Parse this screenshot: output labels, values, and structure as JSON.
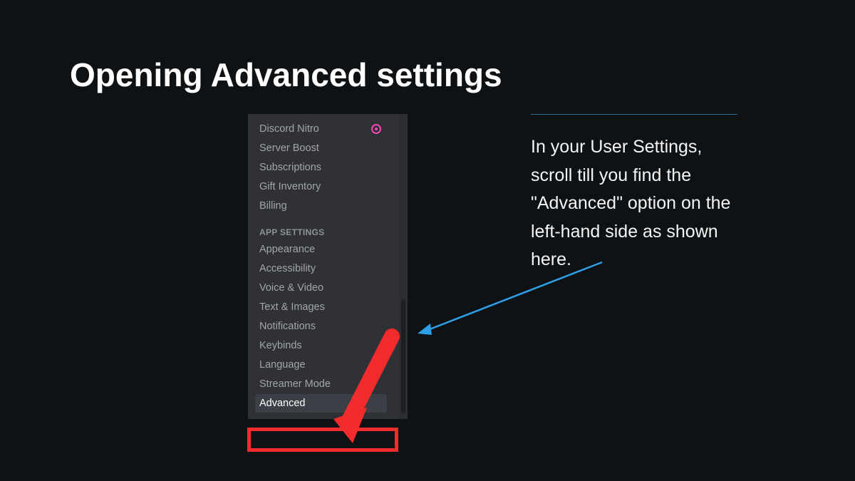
{
  "slide": {
    "title": "Opening Advanced settings"
  },
  "sidebar": {
    "items_top": [
      {
        "label": "Discord Nitro",
        "badge": true
      },
      {
        "label": "Server Boost"
      },
      {
        "label": "Subscriptions"
      },
      {
        "label": "Gift Inventory"
      },
      {
        "label": "Billing"
      }
    ],
    "section_header": "APP SETTINGS",
    "items_app": [
      {
        "label": "Appearance"
      },
      {
        "label": "Accessibility"
      },
      {
        "label": "Voice & Video"
      },
      {
        "label": "Text & Images"
      },
      {
        "label": "Notifications"
      },
      {
        "label": "Keybinds"
      },
      {
        "label": "Language"
      },
      {
        "label": "Streamer Mode"
      },
      {
        "label": "Advanced",
        "selected": true
      }
    ]
  },
  "instruction": {
    "text": "In your User Settings, scroll till you find the \"Advanced\" option on the left-hand side as shown here."
  }
}
